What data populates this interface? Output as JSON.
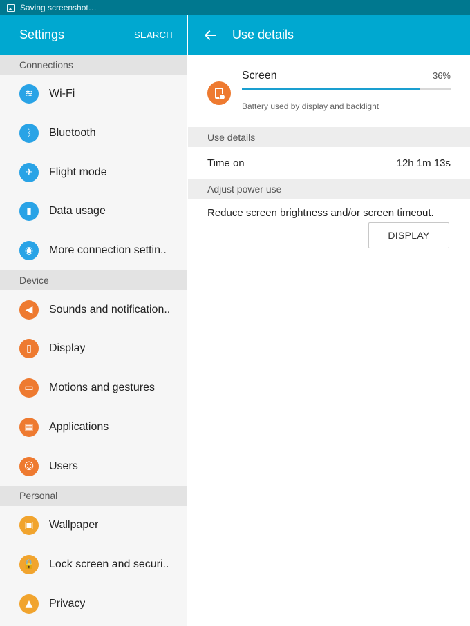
{
  "statusbar": {
    "text": "Saving screenshot…",
    "icon": "image-icon"
  },
  "left": {
    "title": "Settings",
    "search_label": "SEARCH",
    "sections": [
      {
        "header": "Connections",
        "items": [
          {
            "label": "Wi-Fi",
            "icon": "wifi-icon",
            "glyph": "≋",
            "color": "#29a3e6"
          },
          {
            "label": "Bluetooth",
            "icon": "bluetooth-icon",
            "glyph": "ᛒ",
            "color": "#29a3e6"
          },
          {
            "label": "Flight mode",
            "icon": "airplane-icon",
            "glyph": "✈",
            "color": "#29a3e6"
          },
          {
            "label": "Data usage",
            "icon": "bar-chart-icon",
            "glyph": "▮",
            "color": "#29a3e6"
          },
          {
            "label": "More connection settin..",
            "icon": "antenna-icon",
            "glyph": "◉",
            "color": "#29a3e6"
          }
        ]
      },
      {
        "header": "Device",
        "items": [
          {
            "label": "Sounds and notification..",
            "icon": "speaker-icon",
            "glyph": "◀",
            "color": "#ee7a30"
          },
          {
            "label": "Display",
            "icon": "display-icon",
            "glyph": "▯",
            "color": "#ee7a30"
          },
          {
            "label": "Motions and gestures",
            "icon": "motion-icon",
            "glyph": "▭",
            "color": "#ee7a30"
          },
          {
            "label": "Applications",
            "icon": "apps-grid-icon",
            "glyph": "▦",
            "color": "#ee7a30"
          },
          {
            "label": "Users",
            "icon": "users-icon",
            "glyph": "☺",
            "color": "#ee7a30"
          }
        ]
      },
      {
        "header": "Personal",
        "items": [
          {
            "label": "Wallpaper",
            "icon": "wallpaper-icon",
            "glyph": "▣",
            "color": "#f1a42e"
          },
          {
            "label": "Lock screen and securi..",
            "icon": "lock-icon",
            "glyph": "🔒",
            "color": "#f1a42e"
          },
          {
            "label": "Privacy",
            "icon": "privacy-icon",
            "glyph": "▲",
            "color": "#f1a42e"
          }
        ]
      }
    ]
  },
  "right": {
    "title": "Use details",
    "screen": {
      "name": "Screen",
      "percent_label": "36%",
      "bar_fill_fraction": 0.85,
      "description": "Battery used by display and backlight",
      "icon": "screen-settings-icon",
      "color": "#ee7a30"
    },
    "use_details_header": "Use details",
    "time_on_label": "Time on",
    "time_on_value": "12h 1m 13s",
    "adjust_header": "Adjust power use",
    "adjust_text": "Reduce screen brightness and/or screen timeout.",
    "display_button": "DISPLAY"
  },
  "colors": {
    "appbar": "#00a8d0",
    "statusbar": "#00788f",
    "accent_blue": "#29a3e6",
    "accent_orange": "#ee7a30",
    "accent_yellow": "#f1a42e"
  }
}
